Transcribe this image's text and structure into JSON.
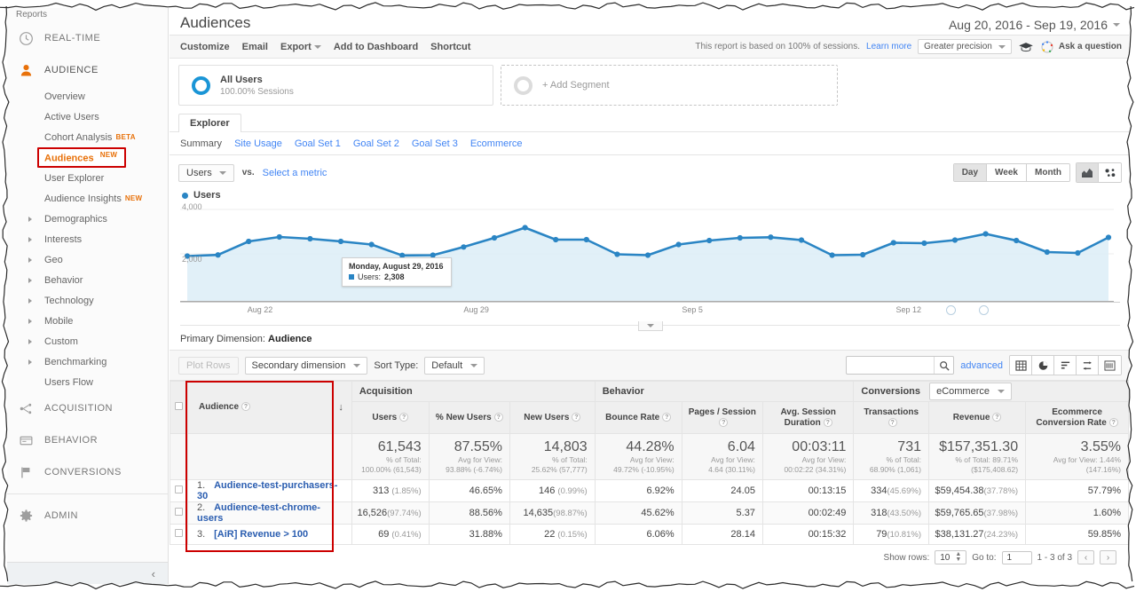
{
  "sidebar": {
    "reports_label": "Reports",
    "sections": [
      {
        "label": "REAL-TIME",
        "icon": "clock-icon"
      },
      {
        "label": "AUDIENCE",
        "icon": "person-icon"
      },
      {
        "label": "ACQUISITION",
        "icon": "acquisition-icon"
      },
      {
        "label": "BEHAVIOR",
        "icon": "behavior-icon"
      },
      {
        "label": "CONVERSIONS",
        "icon": "flag-icon"
      },
      {
        "label": "ADMIN",
        "icon": "gear-icon"
      }
    ],
    "audience_items": [
      {
        "label": "Overview",
        "badge": "",
        "expandable": false,
        "highlighted": false
      },
      {
        "label": "Active Users",
        "badge": "",
        "expandable": false,
        "highlighted": false
      },
      {
        "label": "Cohort Analysis",
        "badge": "BETA",
        "expandable": false,
        "highlighted": false
      },
      {
        "label": "Audiences",
        "badge": "NEW",
        "expandable": false,
        "highlighted": true
      },
      {
        "label": "User Explorer",
        "badge": "",
        "expandable": false,
        "highlighted": false
      },
      {
        "label": "Audience Insights",
        "badge": "NEW",
        "expandable": false,
        "highlighted": false
      },
      {
        "label": "Demographics",
        "badge": "",
        "expandable": true,
        "highlighted": false
      },
      {
        "label": "Interests",
        "badge": "",
        "expandable": true,
        "highlighted": false
      },
      {
        "label": "Geo",
        "badge": "",
        "expandable": true,
        "highlighted": false
      },
      {
        "label": "Behavior",
        "badge": "",
        "expandable": true,
        "highlighted": false
      },
      {
        "label": "Technology",
        "badge": "",
        "expandable": true,
        "highlighted": false
      },
      {
        "label": "Mobile",
        "badge": "",
        "expandable": true,
        "highlighted": false
      },
      {
        "label": "Custom",
        "badge": "",
        "expandable": true,
        "highlighted": false
      },
      {
        "label": "Benchmarking",
        "badge": "",
        "expandable": true,
        "highlighted": false
      },
      {
        "label": "Users Flow",
        "badge": "",
        "expandable": false,
        "highlighted": false
      }
    ],
    "collapse_icon": "‹"
  },
  "header": {
    "title": "Audiences",
    "date_range": "Aug 20, 2016 - Sep 19, 2016"
  },
  "toolbar": {
    "customize": "Customize",
    "email": "Email",
    "export": "Export",
    "add_to_dashboard": "Add to Dashboard",
    "shortcut": "Shortcut",
    "sampling_text": "This report is based on 100% of sessions.",
    "learn_more": "Learn more",
    "precision": "Greater precision",
    "ask_question": "Ask a question"
  },
  "segments": {
    "all_users_title": "All Users",
    "all_users_sub": "100.00% Sessions",
    "add_segment": "+ Add Segment"
  },
  "explorer": {
    "tab": "Explorer",
    "subtabs": [
      {
        "label": "Summary",
        "selected": true
      },
      {
        "label": "Site Usage",
        "selected": false
      },
      {
        "label": "Goal Set 1",
        "selected": false
      },
      {
        "label": "Goal Set 2",
        "selected": false
      },
      {
        "label": "Goal Set 3",
        "selected": false
      },
      {
        "label": "Ecommerce",
        "selected": false
      }
    ]
  },
  "metric_bar": {
    "metric": "Users",
    "vs": "vs.",
    "select_metric": "Select a metric",
    "granularity": [
      {
        "label": "Day",
        "selected": true
      },
      {
        "label": "Week",
        "selected": false
      },
      {
        "label": "Month",
        "selected": false
      }
    ],
    "view_icons": [
      {
        "name": "line-chart-icon",
        "selected": true
      },
      {
        "name": "motion-chart-icon",
        "selected": false
      }
    ]
  },
  "chart_data": {
    "type": "line",
    "title": "",
    "legend": [
      "Users"
    ],
    "legend_position": "top-left",
    "series_color": "#2a85c4",
    "ylabel": "",
    "xlabel": "",
    "ylim": [
      0,
      4000
    ],
    "yticks": [
      2000,
      4000
    ],
    "ytick_labels": [
      "2,000",
      "4,000"
    ],
    "xtick_labels": [
      "Aug 22",
      "Aug 29",
      "Sep 5",
      "Sep 12"
    ],
    "grid": true,
    "x": [
      "Aug 20",
      "Aug 21",
      "Aug 22",
      "Aug 23",
      "Aug 24",
      "Aug 25",
      "Aug 26",
      "Aug 27",
      "Aug 28",
      "Aug 29",
      "Aug 30",
      "Aug 31",
      "Sep 1",
      "Sep 2",
      "Sep 3",
      "Sep 4",
      "Sep 5",
      "Sep 6",
      "Sep 7",
      "Sep 8",
      "Sep 9",
      "Sep 10",
      "Sep 11",
      "Sep 12",
      "Sep 13",
      "Sep 14",
      "Sep 15",
      "Sep 16",
      "Sep 17",
      "Sep 18",
      "Sep 19"
    ],
    "values": [
      1900,
      1950,
      2560,
      2760,
      2680,
      2560,
      2420,
      1930,
      1940,
      2308,
      2720,
      3180,
      2640,
      2640,
      1980,
      1940,
      2420,
      2600,
      2720,
      2750,
      2620,
      1940,
      1960,
      2500,
      2480,
      2620,
      2900,
      2600,
      2080,
      2040,
      2740
    ],
    "annotation": {
      "date": "Monday, August 29, 2016",
      "series": "Users:",
      "value": "2,308"
    }
  },
  "primary_dimension": {
    "label": "Primary Dimension:",
    "value": "Audience"
  },
  "table_controls": {
    "plot_rows": "Plot Rows",
    "secondary_dimension": "Secondary dimension",
    "sort_type_label": "Sort Type:",
    "sort_type_value": "Default",
    "search_value": "",
    "search_placeholder": "",
    "advanced": "advanced",
    "view_icons": [
      {
        "name": "table-view-icon",
        "selected": false
      },
      {
        "name": "pie-view-icon",
        "selected": false
      },
      {
        "name": "bar-view-icon",
        "selected": false
      },
      {
        "name": "comparison-view-icon",
        "selected": false
      },
      {
        "name": "pivot-view-icon",
        "selected": false
      }
    ]
  },
  "table": {
    "groups": [
      {
        "label": "Acquisition",
        "span": 3
      },
      {
        "label": "Behavior",
        "span": 3
      },
      {
        "label": "Conversions",
        "span": 3,
        "dropdown": "eCommerce"
      }
    ],
    "dimension_header": "Audience",
    "columns": [
      "Users",
      "% New Users",
      "New Users",
      "Bounce Rate",
      "Pages / Session",
      "Avg. Session Duration",
      "Transactions",
      "Revenue",
      "Ecommerce Conversion Rate"
    ],
    "summary": [
      {
        "big": "61,543",
        "l1": "% of Total:",
        "l2": "100.00% (61,543)"
      },
      {
        "big": "87.55%",
        "l1": "Avg for View:",
        "l2": "93.88% (-6.74%)"
      },
      {
        "big": "14,803",
        "l1": "% of Total:",
        "l2": "25.62% (57,777)"
      },
      {
        "big": "44.28%",
        "l1": "Avg for View:",
        "l2": "49.72% (-10.95%)"
      },
      {
        "big": "6.04",
        "l1": "Avg for View:",
        "l2": "4.64 (30.11%)"
      },
      {
        "big": "00:03:11",
        "l1": "Avg for View:",
        "l2": "00:02:22 (34.31%)"
      },
      {
        "big": "731",
        "l1": "% of Total:",
        "l2": "68.90% (1,061)"
      },
      {
        "big": "$157,351.30",
        "l1": "% of Total: 89.71%",
        "l2": "($175,408.62)"
      },
      {
        "big": "3.55%",
        "l1": "Avg for View: 1.44%",
        "l2": "(147.16%)"
      }
    ],
    "rows": [
      {
        "num": "1.",
        "name": "Audience-test-purchasers-30",
        "users": "313",
        "users_pct": "(1.85%)",
        "new_users_pct": "46.65%",
        "new_users": "146",
        "new_users_sub": "(0.99%)",
        "bounce": "6.92%",
        "pages": "24.05",
        "duration": "00:13:15",
        "transactions": "334",
        "transactions_pct": "(45.69%)",
        "revenue": "$59,454.38",
        "revenue_pct": "(37.78%)",
        "ecom_rate": "57.79%"
      },
      {
        "num": "2.",
        "name": "Audience-test-chrome-users",
        "users": "16,526",
        "users_pct": "(97.74%)",
        "new_users_pct": "88.56%",
        "new_users": "14,635",
        "new_users_sub": "(98.87%)",
        "bounce": "45.62%",
        "pages": "5.37",
        "duration": "00:02:49",
        "transactions": "318",
        "transactions_pct": "(43.50%)",
        "revenue": "$59,765.65",
        "revenue_pct": "(37.98%)",
        "ecom_rate": "1.60%"
      },
      {
        "num": "3.",
        "name": "[AiR] Revenue > 100",
        "users": "69",
        "users_pct": "(0.41%)",
        "new_users_pct": "31.88%",
        "new_users": "22",
        "new_users_sub": "(0.15%)",
        "bounce": "6.06%",
        "pages": "28.14",
        "duration": "00:15:32",
        "transactions": "79",
        "transactions_pct": "(10.81%)",
        "revenue": "$38,131.27",
        "revenue_pct": "(24.23%)",
        "ecom_rate": "59.85%"
      }
    ]
  },
  "pager": {
    "show_rows_label": "Show rows:",
    "show_rows_value": "10",
    "goto_label": "Go to:",
    "goto_value": "1",
    "range": "1 - 3 of 3",
    "prev": "‹",
    "next": "›"
  },
  "colors": {
    "accent_orange": "#e8710a",
    "link_blue": "#4285f4",
    "chart_blue": "#2a85c4",
    "chart_fill": "#dbeef8",
    "annotation_red": "#cc0000",
    "row_link": "#2a5db0"
  }
}
